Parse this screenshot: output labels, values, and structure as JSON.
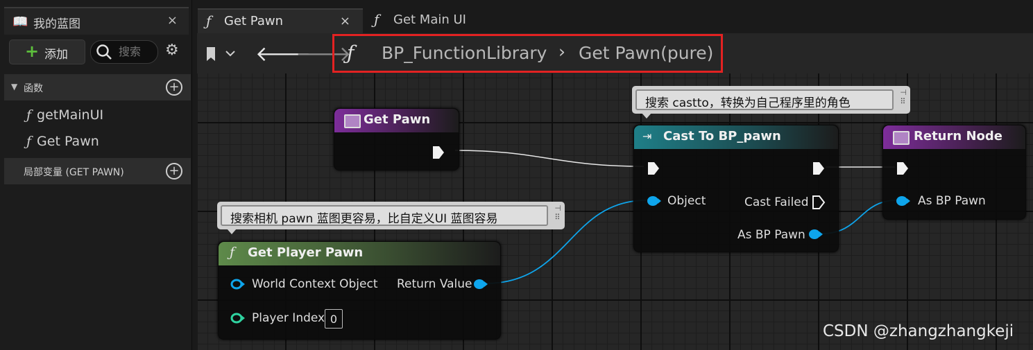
{
  "left_panel": {
    "title": "我的蓝图",
    "close": "×",
    "add_label": "添加",
    "search_placeholder": "搜索",
    "functions_header": "函数",
    "functions": [
      "getMainUI",
      "Get Pawn"
    ],
    "locals_header": "局部变量 (GET PAWN)"
  },
  "tabs": [
    {
      "label": "Get Pawn",
      "close": "×",
      "active": true
    },
    {
      "label": "Get Main UI",
      "active": false
    }
  ],
  "breadcrumb": {
    "library": "BP_FunctionLibrary",
    "separator": "›",
    "current": "Get Pawn(pure)"
  },
  "nodes": {
    "get_pawn": {
      "title": "Get Pawn"
    },
    "cast": {
      "title": "Cast To BP_pawn",
      "pin_object": "Object",
      "pin_cast_failed": "Cast Failed",
      "pin_as": "As BP Pawn"
    },
    "return": {
      "title": "Return Node",
      "pin_as": "As BP Pawn"
    },
    "player_pawn": {
      "title": "Get Player Pawn",
      "pin_world": "World Context Object",
      "pin_index": "Player Index",
      "index_value": "0",
      "pin_return": "Return Value"
    }
  },
  "comments": {
    "cast_comment": "搜索 castto，转换为自己程序里的角色",
    "pawn_comment": "搜索相机 pawn 蓝图更容易，比自定义UI 蓝图容易"
  },
  "watermark": "CSDN @zhangzhangkeji",
  "colors": {
    "accent_red": "#e32222",
    "pin_blue": "#0ea5ec",
    "pin_teal": "#2fd3a0",
    "func_purple": "#7d2d9a"
  }
}
